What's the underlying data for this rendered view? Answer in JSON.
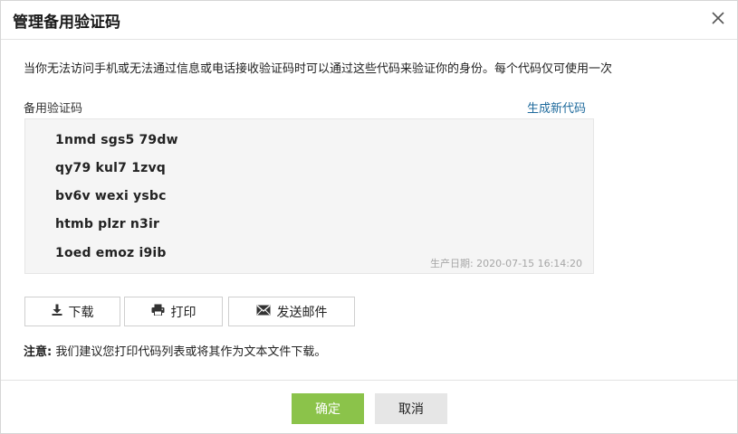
{
  "dialog": {
    "title": "管理备用验证码",
    "close_icon": "close-icon"
  },
  "description": "当你无法访问手机或无法通过信息或电话接收验证码时可以通过这些代码来验证你的身份。每个代码仅可使用一次",
  "codes_section": {
    "label": "备用验证码",
    "generate_link": "生成新代码",
    "codes": [
      "1nmd sgs5 79dw",
      "qy79 kul7 1zvq",
      "bv6v wexi ysbc",
      "htmb plzr n3ir",
      "1oed emoz i9ib"
    ],
    "generated_date": "生产日期: 2020-07-15 16:14:20"
  },
  "actions": {
    "download": {
      "label": "下载",
      "icon": "download-icon"
    },
    "print": {
      "label": "打印",
      "icon": "printer-icon"
    },
    "email": {
      "label": "发送邮件",
      "icon": "envelope-icon"
    }
  },
  "note": {
    "prefix": "注意:",
    "text": "我们建议您打印代码列表或将其作为文本文件下载。"
  },
  "footer": {
    "confirm_label": "确定",
    "cancel_label": "取消"
  },
  "colors": {
    "confirm_button": "#8bc34a",
    "cancel_button": "#e6e6e6",
    "link": "#1e6a9c",
    "codes_background": "#f5f5f5"
  }
}
